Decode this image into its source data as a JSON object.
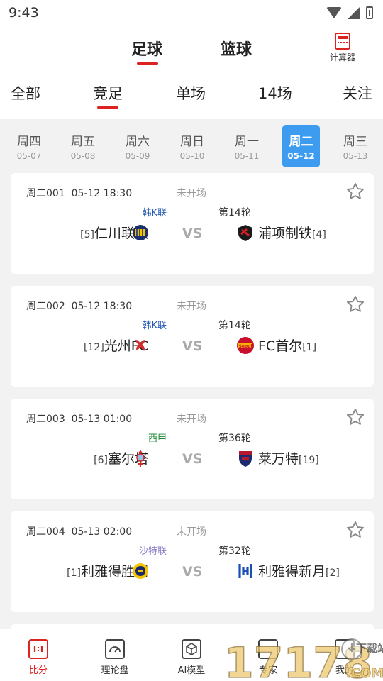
{
  "status_bar": {
    "time": "9:43"
  },
  "sport_tabs": [
    {
      "label": "足球",
      "active": true
    },
    {
      "label": "篮球",
      "active": false
    }
  ],
  "calculator": {
    "label": "计算器"
  },
  "category_tabs": [
    {
      "label": "全部",
      "active": false
    },
    {
      "label": "竞足",
      "active": true
    },
    {
      "label": "单场",
      "active": false
    },
    {
      "label": "14场",
      "active": false
    },
    {
      "label": "关注",
      "active": false
    }
  ],
  "day_tabs": [
    {
      "day": "周四",
      "date": "05-07",
      "active": false
    },
    {
      "day": "周五",
      "date": "05-08",
      "active": false
    },
    {
      "day": "周六",
      "date": "05-09",
      "active": false
    },
    {
      "day": "周日",
      "date": "05-10",
      "active": false
    },
    {
      "day": "周一",
      "date": "05-11",
      "active": false
    },
    {
      "day": "周二",
      "date": "05-12",
      "active": true
    },
    {
      "day": "周三",
      "date": "05-13",
      "active": false
    }
  ],
  "matches": [
    {
      "code": "周二001",
      "time": "05-12 18:30",
      "state": "未开场",
      "league": "韩K联",
      "league_color": "#2b5db5",
      "round": "第14轮",
      "home_rank": "[5]",
      "home": "仁川联队",
      "vs": "VS",
      "away": "浦项制铁",
      "away_rank": "[4]"
    },
    {
      "code": "周二002",
      "time": "05-12 18:30",
      "state": "未开场",
      "league": "韩K联",
      "league_color": "#2b5db5",
      "round": "第14轮",
      "home_rank": "[12]",
      "home": "光州FC",
      "vs": "VS",
      "away": "FC首尔",
      "away_rank": "[1]"
    },
    {
      "code": "周二003",
      "time": "05-13 01:00",
      "state": "未开场",
      "league": "西甲",
      "league_color": "#1f8a3a",
      "round": "第36轮",
      "home_rank": "[6]",
      "home": "塞尔塔",
      "vs": "VS",
      "away": "莱万特",
      "away_rank": "[19]"
    },
    {
      "code": "周二004",
      "time": "05-13 02:00",
      "state": "未开场",
      "league": "沙特联",
      "league_color": "#8a7fc8",
      "round": "第32轮",
      "home_rank": "[1]",
      "home": "利雅得胜利",
      "vs": "VS",
      "away": "利雅得新月",
      "away_rank": "[2]"
    }
  ],
  "bottom_nav": [
    {
      "label": "比分",
      "active": true
    },
    {
      "label": "理论盘",
      "active": false
    },
    {
      "label": "AI模型",
      "active": false
    },
    {
      "label": "专家",
      "active": false
    },
    {
      "label": "我的",
      "active": false
    }
  ],
  "watermark": {
    "text": "17178",
    "suffix": ".COM",
    "badge": "下载站"
  },
  "colors": {
    "accent": "#d22222",
    "day_active": "#3d9cf0"
  }
}
